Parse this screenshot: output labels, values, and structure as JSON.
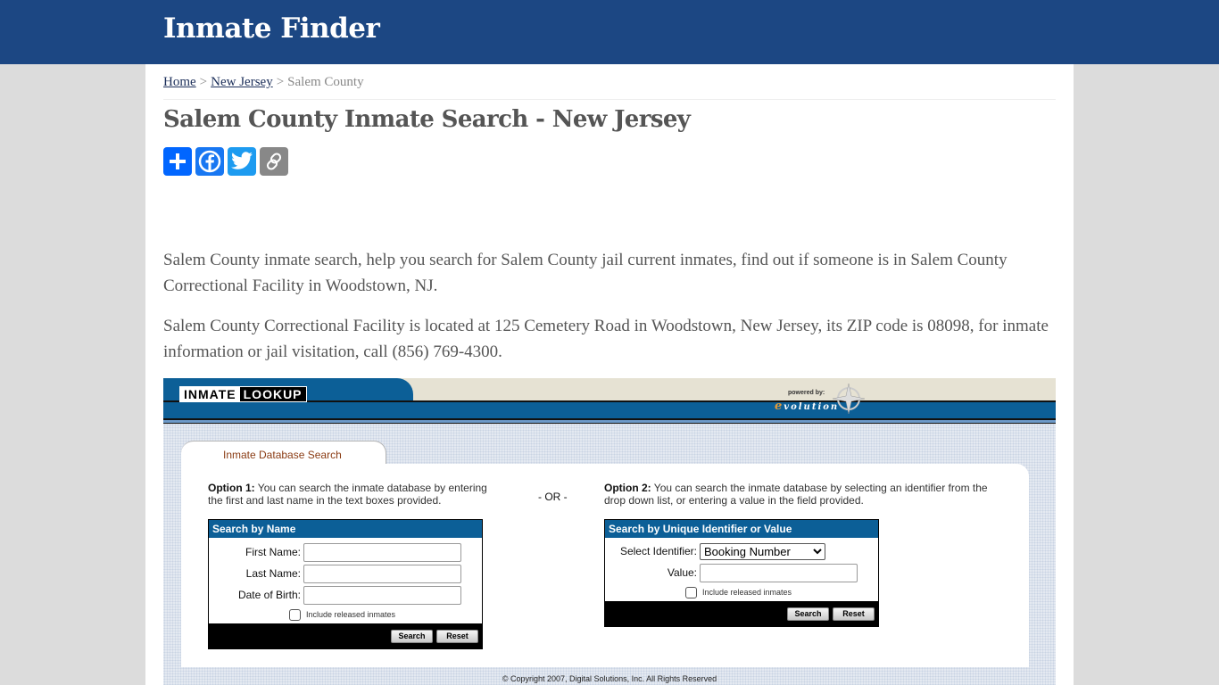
{
  "site": {
    "title": "Inmate Finder"
  },
  "breadcrumb": {
    "items": [
      {
        "label": "Home",
        "link": true
      },
      {
        "label": "New Jersey",
        "link": true
      },
      {
        "label": "Salem County",
        "link": false
      }
    ],
    "separator": ">"
  },
  "page": {
    "title": "Salem County Inmate Search - New Jersey",
    "share": [
      {
        "name": "share-add",
        "icon": "plus-icon",
        "color": "#0166ff"
      },
      {
        "name": "share-facebook",
        "icon": "facebook-icon",
        "color": "#1877f2"
      },
      {
        "name": "share-twitter",
        "icon": "twitter-icon",
        "color": "#1d9bf0"
      },
      {
        "name": "share-copy-link",
        "icon": "link-icon",
        "color": "#888888"
      }
    ],
    "paragraphs": [
      "Salem County inmate search, help you search for Salem County jail current inmates, find out if someone is in Salem County Correctional Facility in Woodstown, NJ.",
      "Salem County Correctional Facility is located at 125 Cemetery Road in Woodstown, New Jersey, its ZIP code is 08098, for inmate information or jail visitation, call (856) 769-4300."
    ]
  },
  "widget": {
    "logo_left": "INMATE",
    "logo_right": "LOOKUP",
    "powered_by": "powered by:",
    "powered_brand_e": "e",
    "powered_brand_rest": "volution",
    "tab_label": "Inmate Database Search",
    "or_label": "- OR -",
    "option1": {
      "heading": "Option 1:",
      "text": " You can search the inmate database by entering the first and last name in the text boxes provided."
    },
    "option2": {
      "heading": "Option 2:",
      "text": " You can search the inmate database by selecting an identifier from the drop down list, or entering a value in the field provided."
    },
    "by_name": {
      "title": "Search by Name",
      "first_name_label": "First Name:",
      "first_name_value": "",
      "last_name_label": "Last Name:",
      "last_name_value": "",
      "dob_label": "Date of Birth:",
      "dob_value": "",
      "include_released_label": "Include released inmates",
      "include_released_checked": false,
      "search_label": "Search",
      "reset_label": "Reset"
    },
    "by_identifier": {
      "title": "Search by Unique Identifier or Value",
      "select_label": "Select Identifier:",
      "selected_option": "Booking Number",
      "value_label": "Value:",
      "value_value": "",
      "include_released_label": "Include released inmates",
      "include_released_checked": false,
      "search_label": "Search",
      "reset_label": "Reset"
    },
    "copyright": "© Copyright 2007, Digital Solutions, Inc. All Rights Reserved"
  },
  "colors": {
    "header_bg": "#1c4783",
    "widget_blue": "#0c5f97",
    "tab_text": "#8a3b13"
  }
}
